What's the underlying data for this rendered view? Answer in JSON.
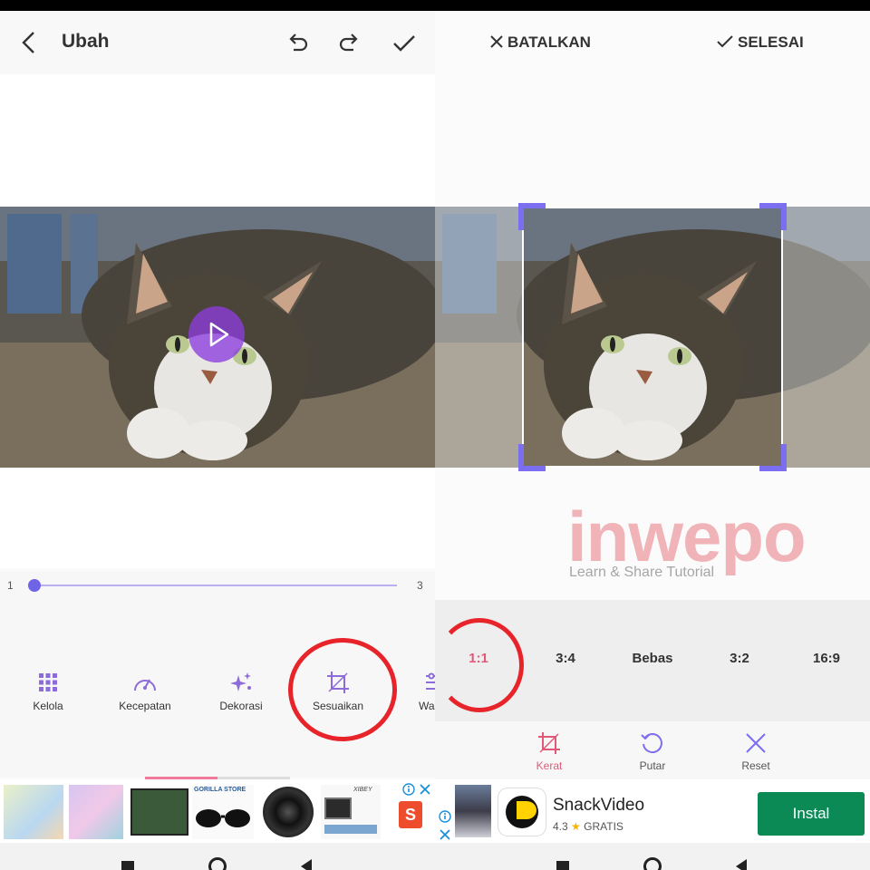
{
  "left": {
    "header": {
      "title": "Ubah"
    },
    "slider": {
      "min": "1",
      "max": "3",
      "value": 1
    },
    "tools": [
      "Kelola",
      "Kecepatan",
      "Dekorasi",
      "Sesuaikan",
      "Wa"
    ],
    "ad": {
      "store_label": "GORILLA STORE",
      "brand_label": "XIBEY"
    }
  },
  "right": {
    "header": {
      "cancel": "BATALKAN",
      "done": "SELESAI"
    },
    "watermark": {
      "brand": "inwepo",
      "tagline": "Learn & Share Tutorial"
    },
    "ratios": [
      "1:1",
      "3:4",
      "Bebas",
      "3:2",
      "16:9"
    ],
    "selected_ratio": "1:1",
    "actions": [
      "Kerat",
      "Putar",
      "Reset"
    ],
    "ad": {
      "app_name": "SnackVideo",
      "rating": "4.3",
      "price": "GRATIS",
      "install": "Instal"
    }
  },
  "colors": {
    "accent": "#7b6ef0",
    "highlight_circle": "#e8242b",
    "install": "#0b8a55",
    "active_action": "#e05a78"
  }
}
